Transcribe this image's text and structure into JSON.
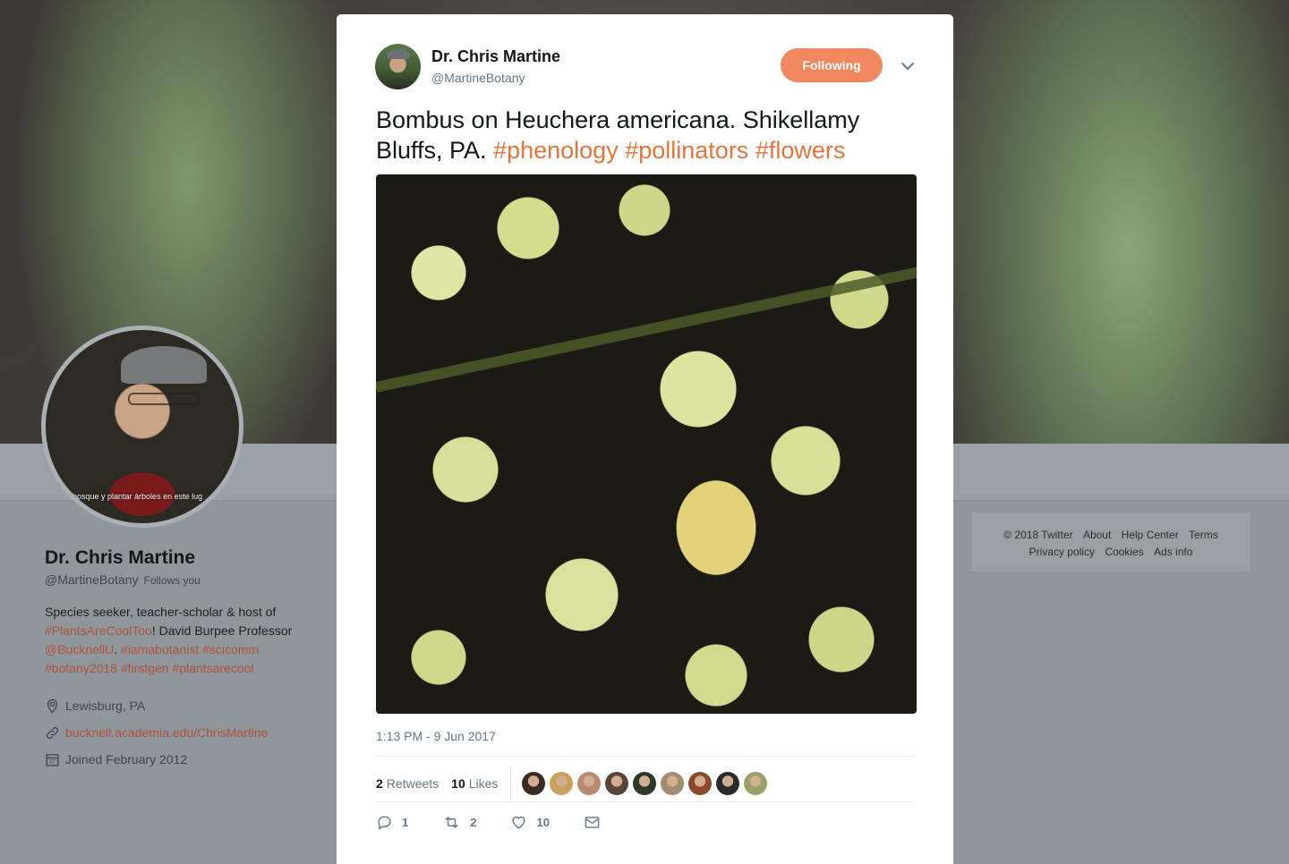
{
  "profile": {
    "name": "Dr. Chris Martine",
    "handle": "@MartineBotany",
    "follows_you": "Follows you",
    "avatar_caption": "bosque y plantar árboles en este lug",
    "bio": {
      "part1": "Species seeker, teacher-scholar & host of ",
      "link1": "#PlantsAreCoolToo",
      "part2": "! David Burpee Professor ",
      "link2": "@BucknellU",
      "part3": ". ",
      "link3": "#iamabotanist",
      "link4": "#scicomm",
      "link5": "#botany2018",
      "link6": "#firstgen",
      "link7": "#plantsarecool"
    },
    "location": "Lewisburg, PA",
    "website": "bucknell.academia.edu/ChrisMartine",
    "joined": "Joined February 2012"
  },
  "footer": {
    "copyright": "© 2018 Twitter",
    "links": [
      "About",
      "Help Center",
      "Terms",
      "Privacy policy",
      "Cookies",
      "Ads info"
    ]
  },
  "tweet": {
    "author_name": "Dr. Chris Martine",
    "author_handle": "@MartineBotany",
    "follow_label": "Following",
    "text": "Bombus on Heuchera americana. Shikellamy Bluffs, PA. ",
    "hashtags": [
      "#phenology",
      "#pollinators",
      "#flowers"
    ],
    "timestamp": "1:13 PM - 9 Jun 2017",
    "retweets_count": "2",
    "retweets_label": "Retweets",
    "likes_count": "10",
    "likes_label": "Likes",
    "liker_avatar_colors": [
      "#3b2a22",
      "#c7a25a",
      "#b98a6e",
      "#5a4438",
      "#2c3a26",
      "#a48a70",
      "#8a4a2a",
      "#2a2a2a",
      "#9aa16a"
    ],
    "actions": {
      "reply_count": "1",
      "retweet_count": "2",
      "like_count": "10"
    }
  },
  "colors": {
    "accent": "#f0875e",
    "hashtag": "#e5743f",
    "link": "#b0523a"
  }
}
